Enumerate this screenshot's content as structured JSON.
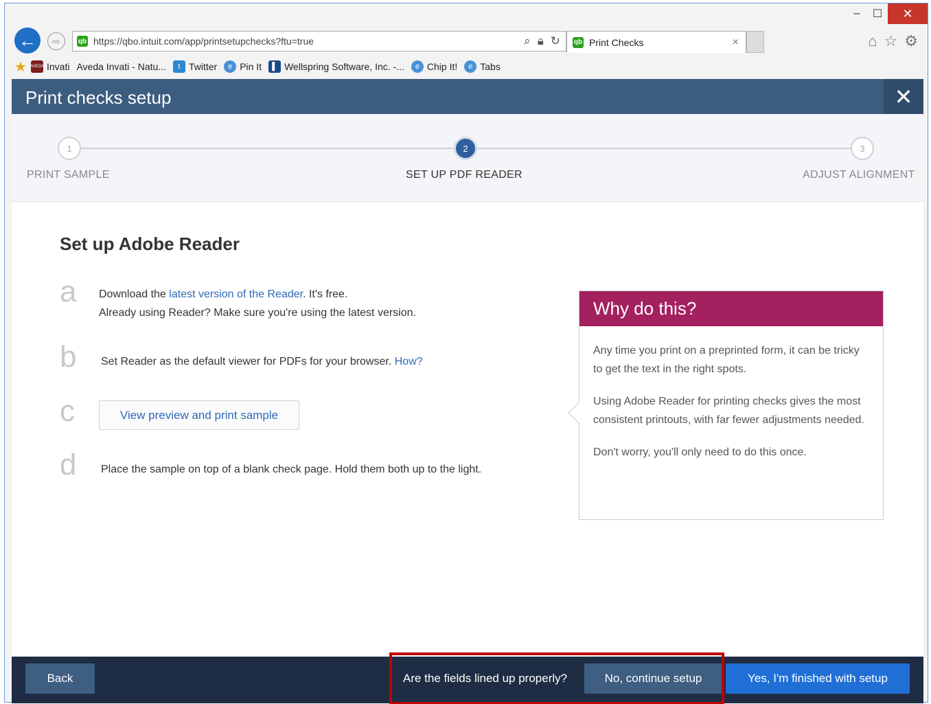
{
  "browser": {
    "url": "https://qbo.intuit.com/app/printsetupchecks?ftu=true",
    "tab_title": "Print Checks",
    "tab_close": "×",
    "minimize": "–",
    "maximize": "☐",
    "close": "✕",
    "back_glyph": "←",
    "forward_glyph": "⇨",
    "favorites": [
      {
        "label": "Invati",
        "icon": "aveda-icon"
      },
      {
        "label": "Aveda Invati - Natu...",
        "icon": ""
      },
      {
        "label": "Twitter",
        "icon": "twitter-icon"
      },
      {
        "label": "Pin It",
        "icon": "ie-icon"
      },
      {
        "label": "Wellspring Software, Inc. -...",
        "icon": "wellspring-icon"
      },
      {
        "label": "Chip It!",
        "icon": "ie-icon"
      },
      {
        "label": "Tabs",
        "icon": "ie-icon"
      }
    ]
  },
  "app": {
    "title": "Print checks setup",
    "close_glyph": "✕",
    "steps": [
      {
        "number": "1",
        "label": "PRINT SAMPLE",
        "active": false
      },
      {
        "number": "2",
        "label": "SET UP PDF READER",
        "active": true
      },
      {
        "number": "3",
        "label": "ADJUST ALIGNMENT",
        "active": false
      }
    ],
    "heading": "Set up Adobe Reader",
    "letters": [
      "a",
      "b",
      "c",
      "d"
    ],
    "step_a": {
      "prefix": "Download the ",
      "link": "latest version of the Reader",
      "suffix": ". It's free.",
      "line2": "Already using Reader? Make sure you're using the latest version."
    },
    "step_b": {
      "text": "Set Reader as the default viewer for PDFs for your browser. ",
      "link": "How?"
    },
    "step_c": {
      "button": "View preview and print sample"
    },
    "step_d": {
      "text": "Place the sample on top of a blank check page. Hold them both up to the light."
    },
    "why": {
      "title": "Why do this?",
      "p1": "Any time you print on a preprinted form, it can be tricky to get the text in the right spots.",
      "p2": "Using Adobe Reader for printing checks gives the most consistent printouts, with far fewer adjustments needed.",
      "p3": "Don't worry, you'll only need to do this once."
    },
    "footer": {
      "back": "Back",
      "question": "Are the fields lined up properly?",
      "no": "No, continue setup",
      "yes": "Yes, I'm finished with setup"
    }
  },
  "colors": {
    "header": "#3c5d7f",
    "accent_why": "#a3215f",
    "primary_button": "#1f6fd6",
    "footer": "#1e2d44",
    "highlight": "#c00000"
  }
}
